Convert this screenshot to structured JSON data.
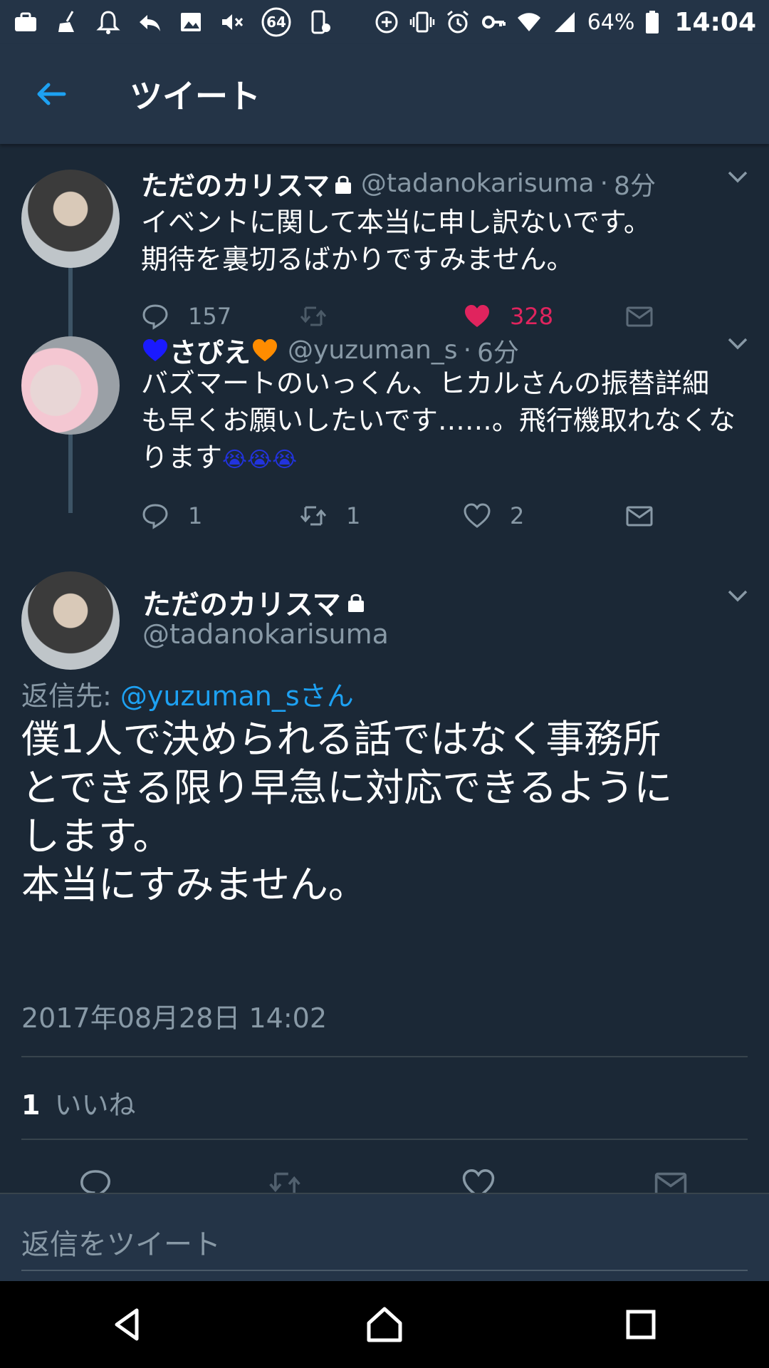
{
  "status_bar": {
    "notification_icons": [
      "briefcase-icon",
      "broom-icon",
      "bell-icon",
      "reply-icon",
      "image-icon",
      "mute-icon",
      "badge-64-icon",
      "device-settings-icon"
    ],
    "badge_text": "64",
    "system_icons": [
      "data-saver-icon",
      "vibrate-icon",
      "alarm-icon",
      "key-icon",
      "wifi-icon",
      "signal-icon",
      "battery-icon"
    ],
    "battery": "64%",
    "time": "14:04"
  },
  "header": {
    "title": "ツイート"
  },
  "thread": [
    {
      "name": "ただのカリスマ",
      "protected": true,
      "handle": "@tadanokarisuma",
      "sep": "·",
      "time": "8分",
      "text_lines": [
        "イベントに関して本当に申し訳ないです。",
        "期待を裏切るばかりですみません。"
      ],
      "replies": "157",
      "retweets": "",
      "likes": "328",
      "liked": true
    },
    {
      "name_prefix_emoji": "💙",
      "name": "さぴえ",
      "name_suffix_emoji": "🧡",
      "handle": "@yuzuman_s",
      "sep": "·",
      "time": "6分",
      "text_lines": [
        "バズマートのいっくん、ヒカルさんの振替詳細",
        "も早くお願いしたいです……。飛行機取れなくな",
        "ります"
      ],
      "text_emoji": "😭😭😭",
      "replies": "1",
      "retweets": "1",
      "likes": "2",
      "liked": false
    }
  ],
  "main_tweet": {
    "name": "ただのカリスマ",
    "handle": "@tadanokarisuma",
    "reply_label": "返信先:",
    "reply_target": "@yuzuman_sさん",
    "text_lines": [
      "僕1人で決められる話ではなく事務所",
      "とできる限り早急に対応できるように",
      "します。",
      "本当にすみません。"
    ],
    "date": "2017年08月28日 14:02",
    "likes_count": "1",
    "likes_label": "いいね"
  },
  "composer": {
    "placeholder": "返信をツイート"
  },
  "colors": {
    "background": "#1b2836",
    "header": "#243447",
    "muted": "#8899a6",
    "link": "#1da1f2",
    "like": "#e0245e"
  }
}
